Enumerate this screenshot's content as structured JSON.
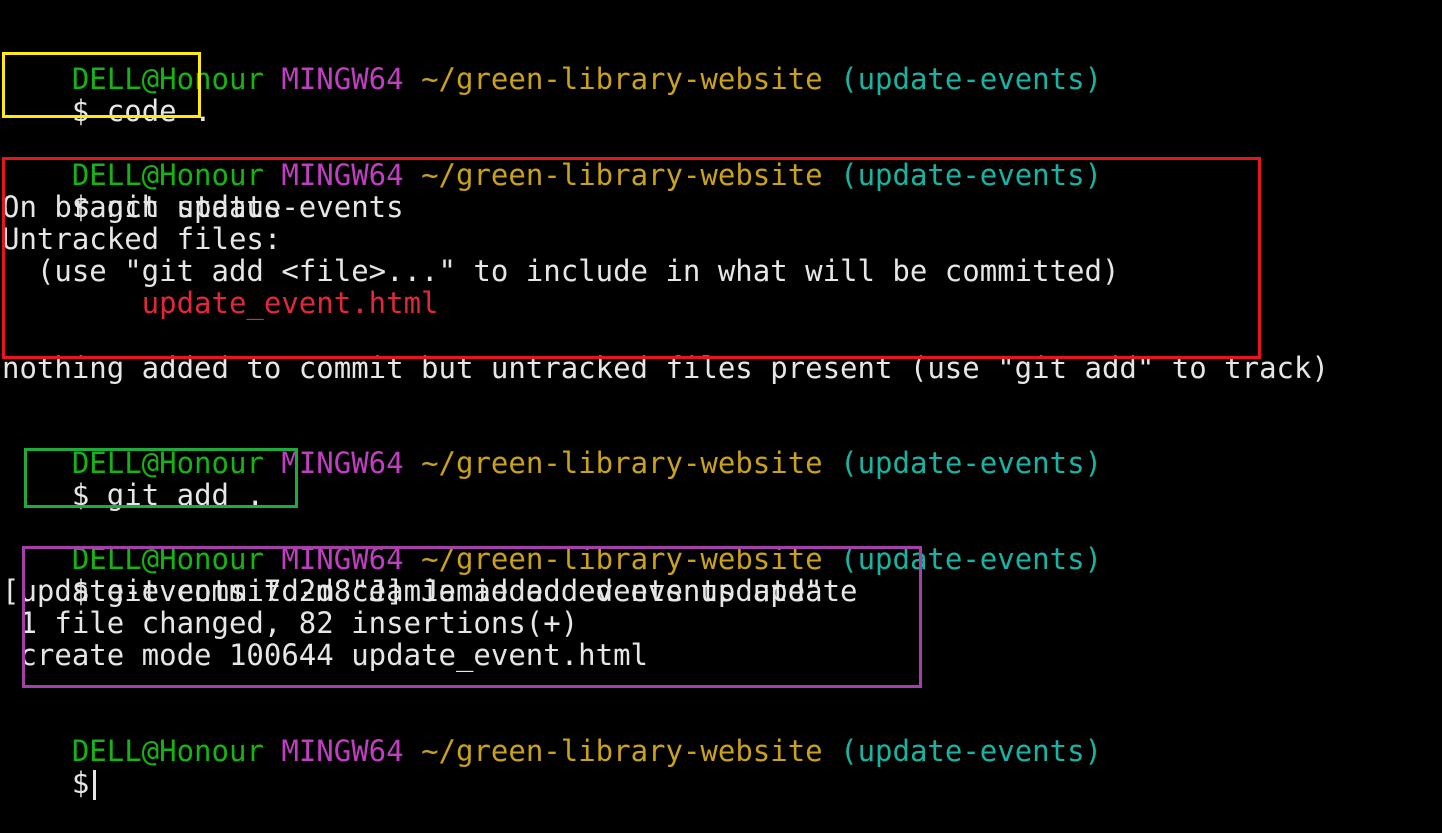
{
  "prompt": {
    "user": "DELL@Honour",
    "host": "MINGW64",
    "path": "~/green-library-website",
    "branch": "(update-events)",
    "symbol": "$"
  },
  "commands": {
    "code": "code .",
    "status": "git status",
    "add": "git add .",
    "commit": "git commit -m \"Jamie added events update\""
  },
  "status_output": {
    "on_branch": "On branch update-events",
    "untracked_header": "Untracked files:",
    "hint": "  (use \"git add <file>...\" to include in what will be committed)",
    "file": "        update_event.html",
    "summary": "nothing added to commit but untracked files present (use \"git add\" to track)"
  },
  "commit_output": {
    "line1": "[update-events 7d2d8ce] Jamie added events update",
    "line2": " 1 file changed, 82 insertions(+)",
    "line3": " create mode 100644 update_event.html"
  },
  "colors": {
    "user": "#16b316",
    "host": "#c03ec0",
    "path": "#c9a21a",
    "branch": "#19b3a3",
    "untracked_file": "#e0283a",
    "box_code": "#ffeb12",
    "box_status": "#e8141e",
    "box_add": "#1faa3e",
    "box_commit": "#a540a8"
  }
}
